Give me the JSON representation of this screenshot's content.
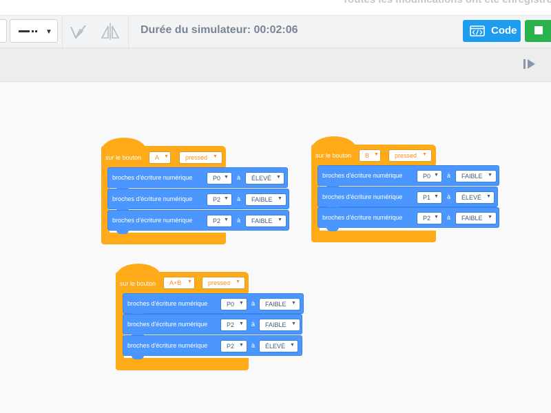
{
  "header": {
    "save_status": "Toutes les modifications ont été enregistrées"
  },
  "toolbar": {
    "sim_duration": "Durée du simulateur: 00:02:06",
    "code_label": "Code",
    "icons": [
      "line-style-icon",
      "pen-icon",
      "flip-icon",
      "code-icon",
      "stop-icon",
      "step-icon"
    ]
  },
  "blocks": [
    {
      "hat_label": "sur le bouton",
      "button": "A",
      "state": "pressed",
      "statements": [
        {
          "label": "broches d'écriture numérique",
          "pin": "P0",
          "to": "à",
          "level": "ÉLEVÉ"
        },
        {
          "label": "broches d'écriture numérique",
          "pin": "P2",
          "to": "à",
          "level": "FAIBLE"
        },
        {
          "label": "broches d'écriture numérique",
          "pin": "P2",
          "to": "à",
          "level": "FAIBLE"
        }
      ]
    },
    {
      "hat_label": "sur le bouton",
      "button": "B",
      "state": "pressed",
      "statements": [
        {
          "label": "broches d'écriture numérique",
          "pin": "P0",
          "to": "à",
          "level": "FAIBLE"
        },
        {
          "label": "broches d'écriture numérique",
          "pin": "P1",
          "to": "à",
          "level": "ÉLEVÉ"
        },
        {
          "label": "broches d'écriture numérique",
          "pin": "P2",
          "to": "à",
          "level": "FAIBLE"
        }
      ]
    },
    {
      "hat_label": "sur le bouton",
      "button": "A+B",
      "state": "pressed",
      "statements": [
        {
          "label": "broches d'écriture numérique",
          "pin": "P0",
          "to": "à",
          "level": "FAIBLE"
        },
        {
          "label": "broches d'écriture numérique",
          "pin": "P2",
          "to": "à",
          "level": "FAIBLE"
        },
        {
          "label": "broches d'écriture numérique",
          "pin": "P2",
          "to": "à",
          "level": "ÉLEVÉ"
        }
      ]
    }
  ],
  "colors": {
    "event": "#ffab19",
    "statement": "#4c97ff",
    "code_button": "#1e9cf0",
    "run_button": "#2bb24c"
  }
}
